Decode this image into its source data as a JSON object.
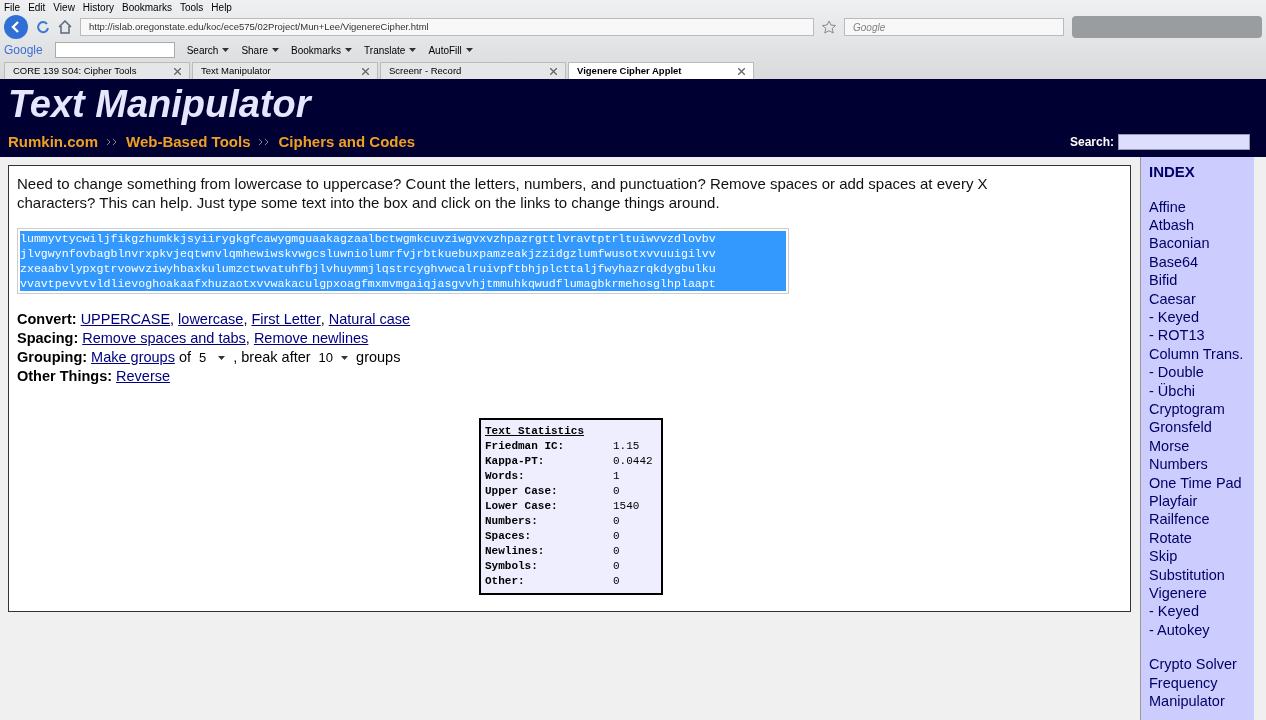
{
  "menu": [
    "File",
    "Edit",
    "View",
    "History",
    "Bookmarks",
    "Tools",
    "Help"
  ],
  "address_bar": {
    "url": "http://islab.oregonstate.edu/koc/ece575/02Project/Mun+Lee/VigenereCipher.html"
  },
  "search_box": {
    "placeholder": "Google"
  },
  "toolbar": {
    "brand": "Google",
    "items": [
      {
        "label": "Search"
      },
      {
        "label": "Share"
      },
      {
        "label": "Bookmarks"
      },
      {
        "label": "Translate"
      },
      {
        "label": "AutoFill"
      }
    ]
  },
  "tabs": [
    {
      "label": "CORE 139 S04: Cipher Tools",
      "selected": false
    },
    {
      "label": "Text Manipulator",
      "selected": false
    },
    {
      "label": "Screenr - Record",
      "selected": false
    },
    {
      "label": "Vigenere Cipher Applet",
      "selected": true
    }
  ],
  "page": {
    "title": "Text Manipulator",
    "breadcrumbs": [
      "Rumkin.com",
      "Web-Based Tools",
      "Ciphers and Codes"
    ],
    "search_label": "Search:",
    "intro": "Need to change something from lowercase to uppercase? Count the letters, numbers, and punctuation? Remove spaces or add spaces at every X characters? This can help. Just type some text into the box and click on the links to change things around.",
    "text_area": {
      "selected": true,
      "lines": [
        "lummyvtycwiljfikgzhumkkjsyiirygkgfcawygmguaakagzaalbctwgmkcuvziwgvxvzhpazrgttlvravtptrltuiwvvzdlovbv",
        "jlvgwynfovbagblnvrxpkvjeqtwnvlqmhewiwskvwgcsluwniolumrfvjrbtkuebuxpamzeakjzzidgzlumfwusotxvvuuigilvv",
        "zxeaabvlypxgtrvowvziwyhbaxkulumzctwvatuhfbjlvhuymmjlqstrcyghvwcalruivpftbhjplcttaljfwyhazrqkdygbulku",
        "vvavtpevvtvldlievoghoakaafxhuzaotxvvwakaculgpxoagfmxmvmgaiqjasgvvhjtmmuhkqwudflumagbkrmehosglhplaapt"
      ]
    },
    "convert": {
      "label": "Convert:",
      "links": [
        "UPPERCASE",
        "lowercase",
        "First Letter",
        "Natural case"
      ],
      "separator": ","
    },
    "spacing": {
      "label": "Spacing:",
      "links": [
        "Remove spaces and tabs",
        "Remove newlines"
      ],
      "separator": ","
    },
    "grouping": {
      "label": "Grouping:",
      "link": "Make groups",
      "of": "of",
      "group_size": "5",
      "break_after": ", break after",
      "break_count": "10",
      "groups": "groups"
    },
    "other": {
      "label": "Other Things:",
      "link": "Reverse"
    },
    "statistics": {
      "title": "Text Statistics",
      "rows": [
        {
          "label": "Friedman IC:",
          "value": "1.15"
        },
        {
          "label": "Kappa-PT:",
          "value": "0.0442"
        },
        {
          "label": "Words:",
          "value": "1"
        },
        {
          "label": "Upper Case:",
          "value": "0"
        },
        {
          "label": "Lower Case:",
          "value": "1540"
        },
        {
          "label": "Numbers:",
          "value": "0"
        },
        {
          "label": "Spaces:",
          "value": "0"
        },
        {
          "label": "Newlines:",
          "value": "0"
        },
        {
          "label": "Symbols:",
          "value": "0"
        },
        {
          "label": "Other:",
          "value": "0"
        }
      ]
    }
  },
  "index": {
    "title": "INDEX",
    "groups": [
      [
        "Affine",
        "Atbash",
        "Baconian",
        "Base64",
        "Bifid",
        "Caesar",
        "- Keyed",
        "- ROT13",
        "Column Trans.",
        "- Double",
        "- Übchi",
        "Cryptogram",
        "Gronsfeld",
        "Morse",
        "Numbers",
        "One Time Pad",
        "Playfair",
        "Railfence",
        "Rotate",
        "Skip",
        "Substitution",
        "Vigenere",
        "- Keyed",
        "- Autokey"
      ],
      [
        "Crypto Solver",
        "Frequency",
        "Manipulator"
      ]
    ]
  }
}
